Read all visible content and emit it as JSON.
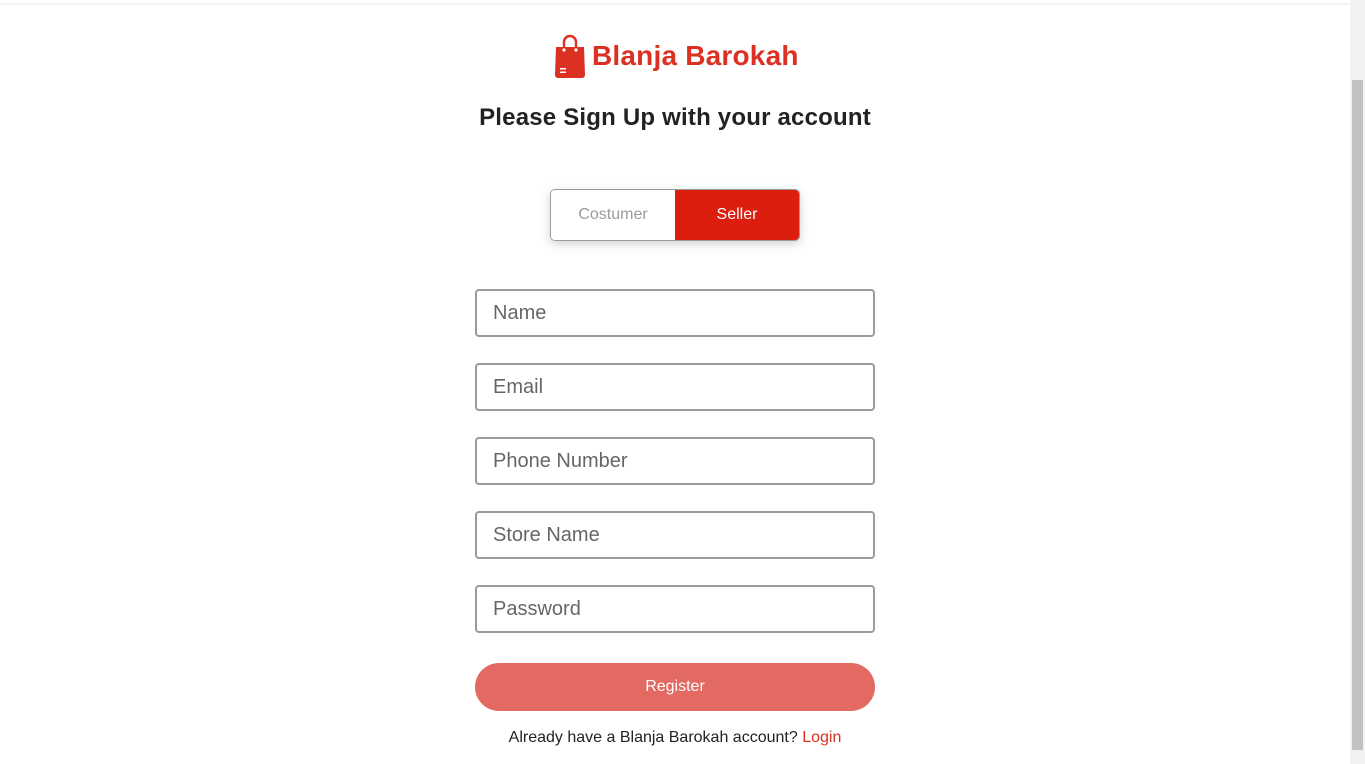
{
  "brand": {
    "name": "Blanja Barokah",
    "icon": "shopping-bag-icon",
    "color": "#DB3022"
  },
  "heading": "Please Sign Up with your account",
  "role_toggle": {
    "options": [
      "Costumer",
      "Seller"
    ],
    "selected": "Seller",
    "active_color": "#DB1E0E"
  },
  "form": {
    "name_placeholder": "Name",
    "email_placeholder": "Email",
    "phone_placeholder": "Phone Number",
    "store_placeholder": "Store Name",
    "password_placeholder": "Password",
    "submit_label": "Register",
    "submit_color": "#E26A62"
  },
  "footer": {
    "prompt": "Already have a Blanja Barokah account?",
    "link_label": "Login"
  }
}
